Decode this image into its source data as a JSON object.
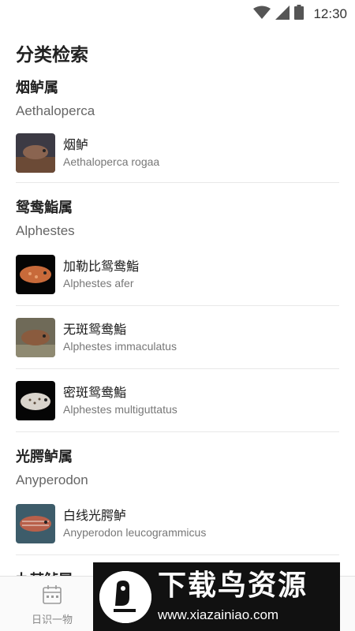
{
  "status": {
    "time": "12:30",
    "icons": [
      "wifi-icon",
      "signal-icon",
      "battery-icon"
    ]
  },
  "page": {
    "title": "分类检索"
  },
  "genera": [
    {
      "name": "烟鲈属",
      "latin": "Aethaloperca",
      "species": [
        {
          "cn": "烟鲈",
          "latin": "Aethaloperca rogaa",
          "thumb_color": "#6b4a36"
        }
      ]
    },
    {
      "name": "鸳鸯鮨属",
      "latin": "Alphestes",
      "species": [
        {
          "cn": "加勒比鸳鸯鮨",
          "latin": "Alphestes afer",
          "thumb_color": "#c86a3a"
        },
        {
          "cn": "无斑鸳鸯鮨",
          "latin": "Alphestes immaculatus",
          "thumb_color": "#8a5b3e"
        },
        {
          "cn": "密斑鸳鸯鮨",
          "latin": "Alphestes multiguttatus",
          "thumb_color": "#d9d4cc"
        }
      ]
    },
    {
      "name": "光腭鲈属",
      "latin": "Anyperodon",
      "species": [
        {
          "cn": "白线光腭鲈",
          "latin": "Anyperodon leucogrammicus",
          "thumb_color": "#b8604a"
        }
      ]
    },
    {
      "name": "九棘鲈属",
      "latin": "",
      "species": []
    }
  ],
  "bottom_nav": {
    "items": [
      {
        "label": "日识一物",
        "icon": "calendar-icon"
      }
    ]
  },
  "watermark": {
    "title": "下载鸟资源",
    "url": "www.xiazainiao.com"
  }
}
